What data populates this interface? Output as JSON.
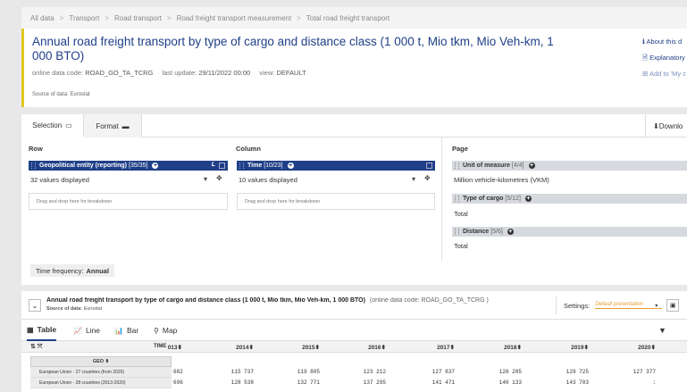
{
  "breadcrumb": [
    "All data",
    "Transport",
    "Road transport",
    "Road freight transport measurement",
    "Total road freight transport"
  ],
  "breadcrumb_sep": ">",
  "header": {
    "title": "Annual road freight transport by type of cargo and distance class (1 000 t, Mio tkm, Mio Veh-km, 1 000 BTO)",
    "code_label": "online data code:",
    "code": "ROAD_GO_TA_TCRG",
    "update_label": "last update:",
    "update": "29/11/2022 00:00",
    "view_label": "view:",
    "view": "DEFAULT",
    "source_label": "Source of data:",
    "source": "Eurostat",
    "links": [
      "About this d",
      "Explanatory",
      "Add to 'My c"
    ]
  },
  "tabs": {
    "selection": "Selection",
    "format": "Format",
    "download": "Downlo"
  },
  "columns": {
    "row": "Row",
    "column": "Column",
    "page": "Page"
  },
  "row_dim": {
    "name": "Geopolitical entity (reporting)",
    "count": "[35/35]",
    "values": "32 values displayed",
    "drop": "Drag and drop here for breakdown"
  },
  "col_dim": {
    "name": "Time",
    "count": "[10/23]",
    "values": "10 values displayed",
    "drop": "Drag and drop here for breakdown"
  },
  "page_dims": [
    {
      "name": "Unit of measure",
      "count": "[4/4]",
      "value": "Million vehicle-kilometres (VKM)"
    },
    {
      "name": "Type of cargo",
      "count": "[5/12]",
      "value": "Total"
    },
    {
      "name": "Distance",
      "count": "[5/6]",
      "value": "Total"
    }
  ],
  "time_frequency": {
    "label": "Time frequency:",
    "value": "Annual"
  },
  "data_header": {
    "title": "Annual road freight transport by type of cargo and distance class (1 000 t, Mio tkm, Mio Veh-km, 1 000 BTO)",
    "code": "(online data code: ROAD_GO_TA_TCRG )",
    "source_label": "Source of data:",
    "source": "Eurostat",
    "settings_label": "Settings:",
    "presentation": "Default presentation"
  },
  "view_tabs": [
    "Table",
    "Line",
    "Bar",
    "Map"
  ],
  "table": {
    "tools": "⇅ ⤧",
    "time_label": "TIME",
    "geo_label": "GEO",
    "years": [
      "013",
      "2014",
      "2015",
      "2016",
      "2017",
      "2018",
      "2019",
      "2020"
    ],
    "rows": [
      {
        "geo": "European Union - 27 countries (from 2020)",
        "values": [
          "682",
          "115 737",
          "119 805",
          "123 212",
          "127 837",
          "126 285",
          "129 725",
          "127 377"
        ]
      },
      {
        "geo": "European Union - 28 countries (2013-2020)",
        "values": [
          "696",
          "128 538",
          "132 771",
          "137 295",
          "141 471",
          "140 133",
          "143 703",
          ":"
        ]
      }
    ]
  }
}
